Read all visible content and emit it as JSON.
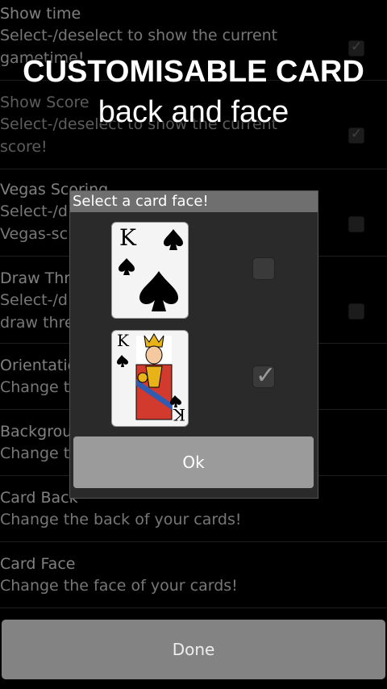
{
  "settings": {
    "items": [
      {
        "title": "Show time",
        "desc": "Select-/deselect to show the current\ngametime!",
        "checked": true
      },
      {
        "title": "Show Score",
        "desc": "Select-/deselect to show the current\nscore!",
        "checked": true
      },
      {
        "title": "Vegas Scoring",
        "desc": "Select-/d\nVegas-sc",
        "checked": false
      },
      {
        "title": "Draw Thr",
        "desc": "Select-/d\ndraw thre",
        "checked": false
      },
      {
        "title": "Orientatio",
        "desc": "Change t"
      },
      {
        "title": "Backgrou",
        "desc": "Change t"
      },
      {
        "title": "Card Back",
        "desc": "Change the back of your cards!"
      },
      {
        "title": "Card Face",
        "desc": "Change the face of your cards!"
      }
    ],
    "done_label": "Done"
  },
  "overlay": {
    "line1": "CUSTOMISABLE CARD",
    "line2": "back and face"
  },
  "dialog": {
    "title": "Select a card face!",
    "ok_label": "Ok",
    "options": [
      {
        "name": "simple-king-of-spades",
        "rank": "K",
        "checked": false
      },
      {
        "name": "illustrated-king-of-clubs",
        "rank": "K",
        "checked": true
      }
    ]
  }
}
